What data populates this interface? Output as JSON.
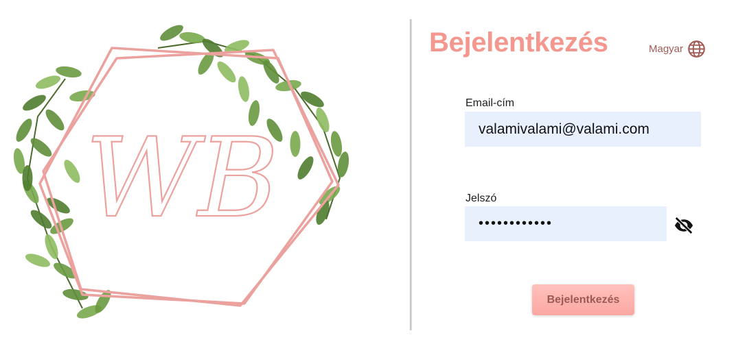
{
  "logo": {
    "monogram": "WB",
    "frame_color": "#eba29e",
    "leaf_color": "#6e9e45"
  },
  "login": {
    "title": "Bejelentkezés",
    "language_label": "Magyar",
    "email_label": "Email-cím",
    "email_value": "valamivalami@valami.com",
    "password_label": "Jelszó",
    "password_value": "••••••••••••",
    "submit_label": "Bejelentkezés",
    "password_toggle_icon": "eye-slash-icon",
    "language_icon": "globe-icon"
  },
  "colors": {
    "accent": "#f4978e",
    "input_bg": "#e8f0fe",
    "button_bg": "#fca7a1",
    "button_text": "#9a5a55"
  }
}
